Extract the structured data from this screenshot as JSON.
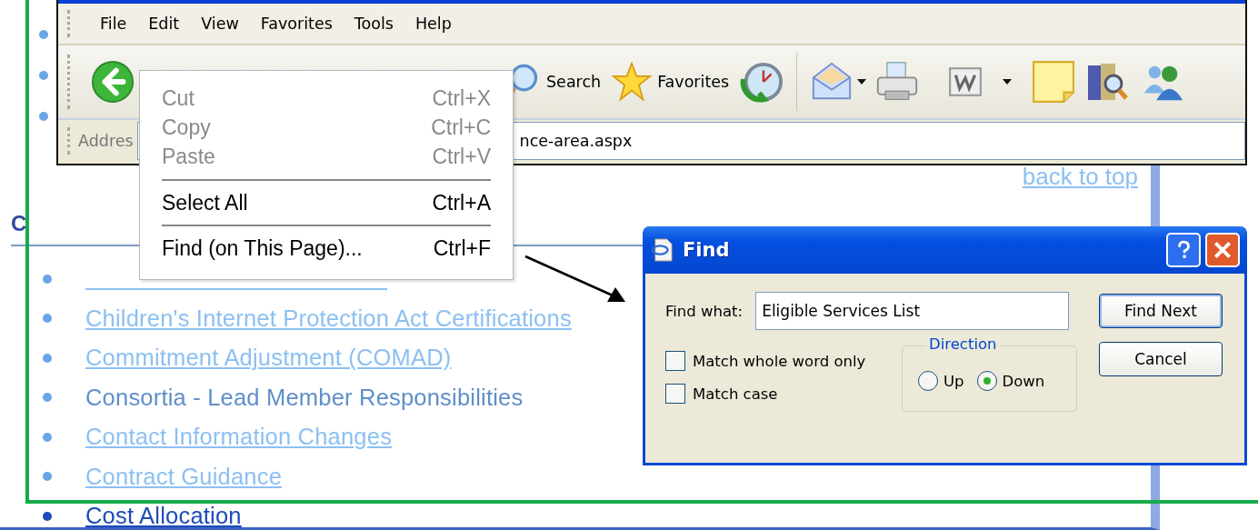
{
  "page": {
    "back_to_top": "back to top",
    "heading": "C",
    "links": [
      {
        "kind": "covered"
      },
      {
        "text": "Children's Internet Protection Act Certifications",
        "kind": "link"
      },
      {
        "text": "Commitment Adjustment (COMAD)",
        "kind": "link"
      },
      {
        "text": "Consortia - Lead Member Responsibilities",
        "kind": "plain"
      },
      {
        "text": "Contact Information Changes",
        "kind": "link"
      },
      {
        "text": "Contract Guidance",
        "kind": "link"
      },
      {
        "text": "Cost Allocation",
        "kind": "active"
      }
    ]
  },
  "browser": {
    "menu": [
      "File",
      "Edit",
      "View",
      "Favorites",
      "Tools",
      "Help"
    ],
    "toolbar": [
      {
        "label": "Search"
      },
      {
        "label": "Favorites"
      }
    ],
    "address": {
      "label": "Addres",
      "value": "nce-area.aspx"
    }
  },
  "context_menu": {
    "items": [
      {
        "kind": "item",
        "label": "Cut",
        "shortcut": "Ctrl+X",
        "disabled": true
      },
      {
        "kind": "item",
        "label": "Copy",
        "shortcut": "Ctrl+C",
        "disabled": true
      },
      {
        "kind": "item",
        "label": "Paste",
        "shortcut": "Ctrl+V",
        "disabled": true
      },
      {
        "kind": "separator"
      },
      {
        "kind": "item",
        "label": "Select All",
        "shortcut": "Ctrl+A",
        "disabled": false
      },
      {
        "kind": "separator"
      },
      {
        "kind": "item",
        "label": "Find (on This Page)...",
        "shortcut": "Ctrl+F",
        "disabled": false
      }
    ]
  },
  "find_dialog": {
    "title": "Find",
    "find_what_label": "Find what:",
    "find_what_value": "Eligible Services List",
    "options": [
      {
        "label": "Match whole word only",
        "checked": false
      },
      {
        "label": "Match case",
        "checked": false
      }
    ],
    "direction": {
      "label": "Direction",
      "options": [
        {
          "label": "Up",
          "selected": false
        },
        {
          "label": "Down",
          "selected": true
        }
      ]
    },
    "buttons": [
      {
        "label": "Find Next",
        "default": true
      },
      {
        "label": "Cancel",
        "default": false
      }
    ]
  }
}
